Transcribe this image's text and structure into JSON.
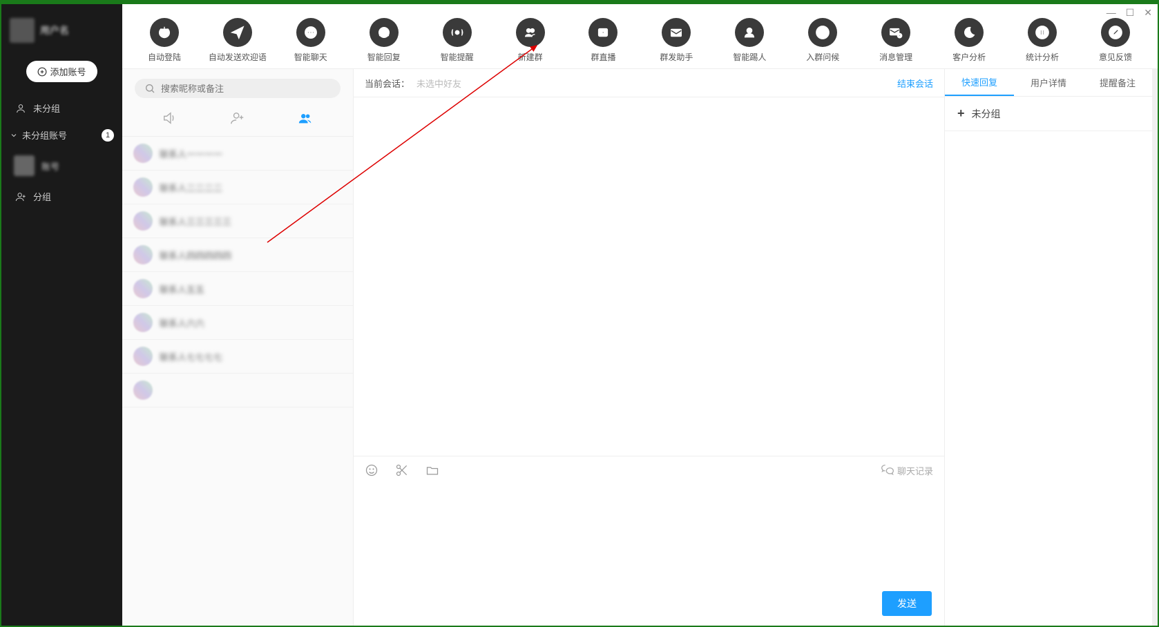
{
  "profile": {
    "name": "用户名"
  },
  "sidebar": {
    "add_account": "添加账号",
    "ungrouped": "未分组",
    "ungrouped_accounts": "未分组账号",
    "badge": "1",
    "account_name": "账号",
    "group": "分组"
  },
  "toolbar": [
    {
      "key": "auto-login",
      "label": "自动登陆",
      "icon": "power"
    },
    {
      "key": "auto-welcome",
      "label": "自动发送欢迎语",
      "icon": "send"
    },
    {
      "key": "smart-chat",
      "label": "智能聊天",
      "icon": "chat"
    },
    {
      "key": "smart-reply",
      "label": "智能回复",
      "icon": "headset"
    },
    {
      "key": "smart-remind",
      "label": "智能提醒",
      "icon": "broadcast"
    },
    {
      "key": "new-group",
      "label": "新建群",
      "icon": "group-add"
    },
    {
      "key": "group-live",
      "label": "群直播",
      "icon": "live"
    },
    {
      "key": "mass-send",
      "label": "群发助手",
      "icon": "mail-many"
    },
    {
      "key": "smart-kick",
      "label": "智能踢人",
      "icon": "person-x"
    },
    {
      "key": "join-greet",
      "label": "入群问候",
      "icon": "hi"
    },
    {
      "key": "msg-manage",
      "label": "消息管理",
      "icon": "mail-gear"
    },
    {
      "key": "customer",
      "label": "客户分析",
      "icon": "moon"
    },
    {
      "key": "stats",
      "label": "统计分析",
      "icon": "pause"
    },
    {
      "key": "feedback",
      "label": "意见反馈",
      "icon": "pencil"
    }
  ],
  "search": {
    "placeholder": "搜索昵称或备注"
  },
  "contacts": [
    {
      "name": "联系人一一一一"
    },
    {
      "name": "联系人二二二二"
    },
    {
      "name": "联系人三三三三三"
    },
    {
      "name": "联系人四四四四四"
    },
    {
      "name": "联系人五五"
    },
    {
      "name": "联系人六六"
    },
    {
      "name": "联系人七七七七"
    },
    {
      "name": ""
    }
  ],
  "chat": {
    "header_label": "当前会话：",
    "header_value": "未选中好友",
    "end_session": "结束会话",
    "log": "聊天记录",
    "send": "发送"
  },
  "detail": {
    "tabs": {
      "quick": "快速回复",
      "user": "用户详情",
      "note": "提醒备注"
    },
    "group_label": "未分组"
  }
}
